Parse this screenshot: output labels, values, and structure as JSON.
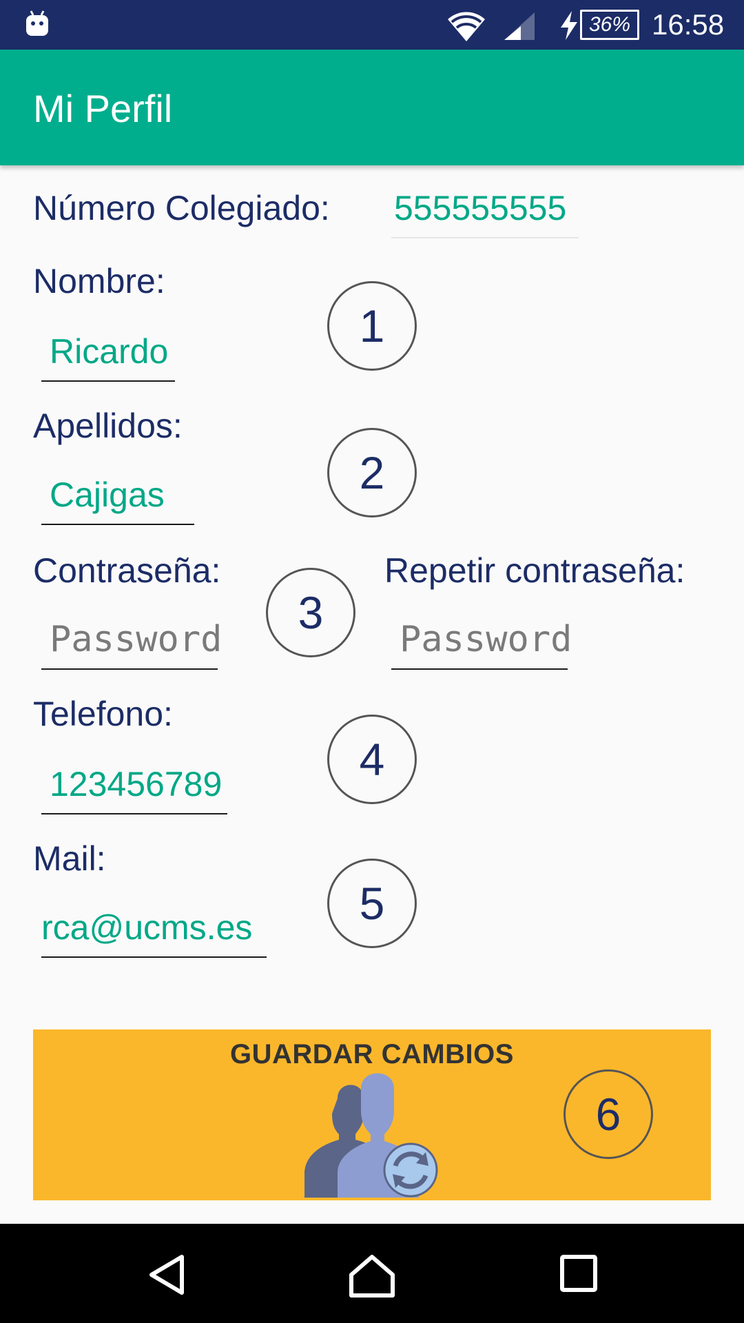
{
  "status_bar": {
    "battery": "36%",
    "time": "16:58",
    "icons": [
      "android-icon",
      "wifi-icon",
      "signal-icon",
      "charging-icon",
      "battery-icon"
    ]
  },
  "app_bar": {
    "title": "Mi Perfil"
  },
  "form": {
    "colegiado": {
      "label": "Número Colegiado:",
      "value": "555555555"
    },
    "nombre": {
      "label": "Nombre:",
      "value": "Ricardo"
    },
    "apellidos": {
      "label": "Apellidos:",
      "value": "Cajigas"
    },
    "contrasena": {
      "label": "Contraseña:",
      "placeholder": "Password"
    },
    "repetir": {
      "label": "Repetir contraseña:",
      "placeholder": "Password"
    },
    "telefono": {
      "label": "Telefono:",
      "value": "123456789"
    },
    "mail": {
      "label": "Mail:",
      "value": "rca@ucms.es"
    }
  },
  "markers": [
    "1",
    "2",
    "3",
    "4",
    "5",
    "6"
  ],
  "save_button": {
    "label": "GUARDAR CAMBIOS",
    "icon": "users-sync-icon"
  },
  "nav_bar": {
    "icons": [
      "back-icon",
      "home-icon",
      "recents-icon"
    ]
  },
  "colors": {
    "status_bar": "#1c2c66",
    "app_bar": "#00ae8d",
    "label_text": "#1c2c66",
    "value_text": "#00a887",
    "save_button": "#fbb72b"
  }
}
